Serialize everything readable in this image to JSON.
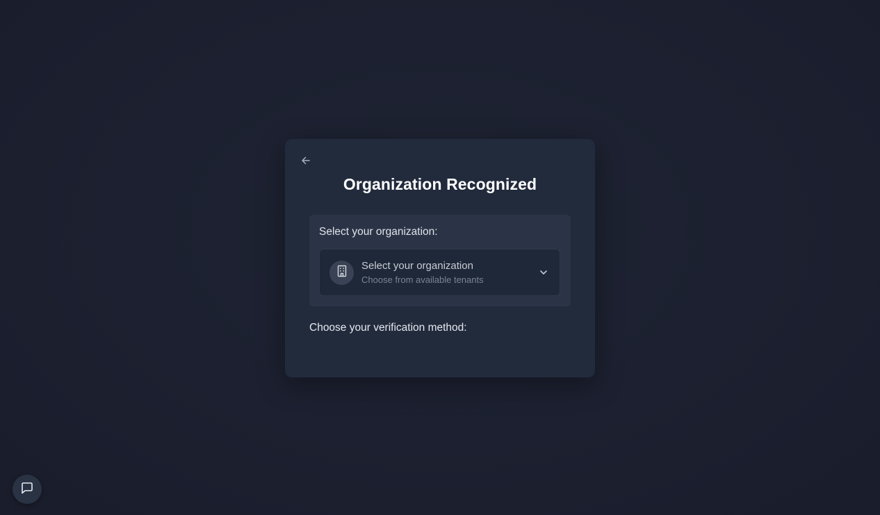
{
  "page": {
    "title": "Organization Recognized"
  },
  "icons": {
    "back": "arrow-left-icon",
    "building": "building-icon",
    "chevron": "chevron-down-icon",
    "chat": "chat-icon"
  },
  "organization_panel": {
    "label": "Select your organization:",
    "select": {
      "title": "Select your organization",
      "subtitle": "Choose from available tenants"
    }
  },
  "verification": {
    "label": "Choose your verification method:"
  },
  "colors": {
    "background": "#1c2030",
    "card": "#222b3c",
    "panel": "#2b3446",
    "select": "#1f2838"
  }
}
